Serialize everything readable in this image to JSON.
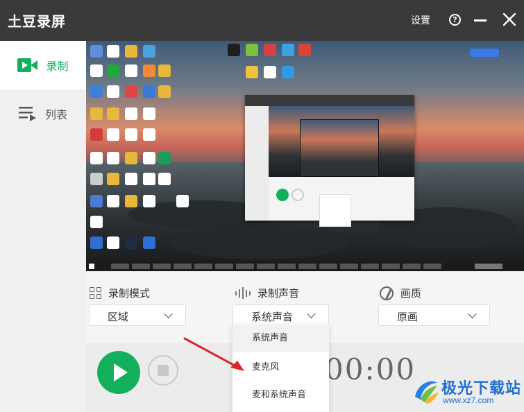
{
  "app": {
    "title": "土豆录屏"
  },
  "titlebar": {
    "settings_label": "设置",
    "help_glyph": "?"
  },
  "sidebar": {
    "items": [
      {
        "label": "录制",
        "icon": "video-record-icon",
        "active": true
      },
      {
        "label": "列表",
        "icon": "list-icon",
        "active": false
      }
    ]
  },
  "settings": {
    "mode": {
      "label": "录制模式",
      "value": "区域",
      "icon": "grid-icon"
    },
    "sound": {
      "label": "录制声音",
      "value": "系统声音",
      "icon": "soundwave-icon"
    },
    "quality": {
      "label": "画质",
      "value": "原画",
      "icon": "quality-icon"
    }
  },
  "sound_dropdown": {
    "options": [
      "系统声音",
      "麦克风",
      "麦和系统声音"
    ],
    "selected": "系统声音"
  },
  "timer": {
    "value": "00:00:00",
    "visible_text": "00:00"
  },
  "watermark": {
    "title": "极光下载站",
    "url": "www.xz7.com"
  },
  "colors": {
    "accent": "#12b05d",
    "titlebar": "#3a3a3a",
    "arrow": "#d9252a",
    "watermark": "#1f6fd0"
  }
}
